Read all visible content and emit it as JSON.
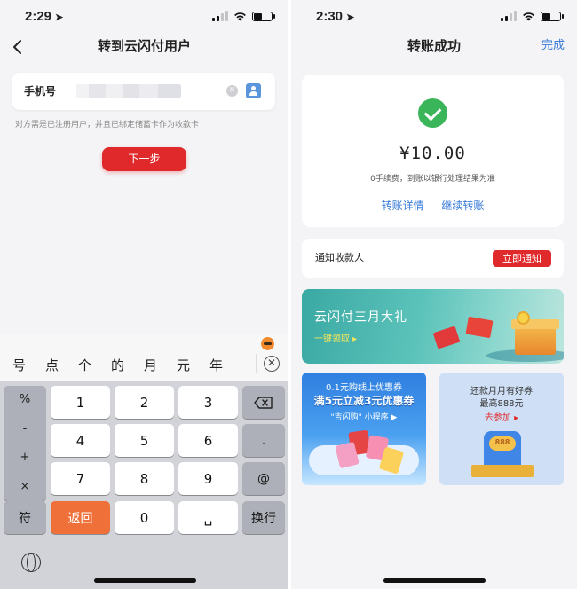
{
  "left": {
    "status_time": "2:29",
    "nav_title": "转到云闪付用户",
    "phone_label": "手机号",
    "hint": "对方需是已注册用户，并且已绑定储蓄卡作为收款卡",
    "next_button": "下一步",
    "candidates": [
      "号",
      "点",
      "个",
      "的",
      "月",
      "元",
      "年"
    ],
    "keyboard": {
      "side_keys": [
        "%",
        "-",
        "+",
        "×"
      ],
      "digits": [
        "1",
        "2",
        "3",
        "4",
        "5",
        "6",
        "7",
        "8",
        "9"
      ],
      "dot_key": ".",
      "at_key": "@",
      "symbol_key": "符",
      "return_key": "返回",
      "zero_key": "0",
      "space_key": "␣",
      "switch_key": "换行"
    }
  },
  "right": {
    "status_time": "2:30",
    "nav_title": "转账成功",
    "done_label": "完成",
    "amount": "¥10.00",
    "fee_note": "0手续费，到账以银行处理结果为准",
    "link_details": "转账详情",
    "link_continue": "继续转账",
    "notify_label": "通知收款人",
    "notify_button": "立即通知",
    "banner": {
      "title": "云闪付三月大礼",
      "cta": "一键领取 ▸"
    },
    "promo1": {
      "line1": "0.1元购线上优惠券",
      "line2": "满5元立减3元优惠券",
      "line3": "\"吉闪购\" 小程序 ▶"
    },
    "promo2": {
      "line1": "还款月月有好券",
      "line2": "最高888元",
      "line3": "去参加 ▸",
      "badge": "888"
    }
  }
}
